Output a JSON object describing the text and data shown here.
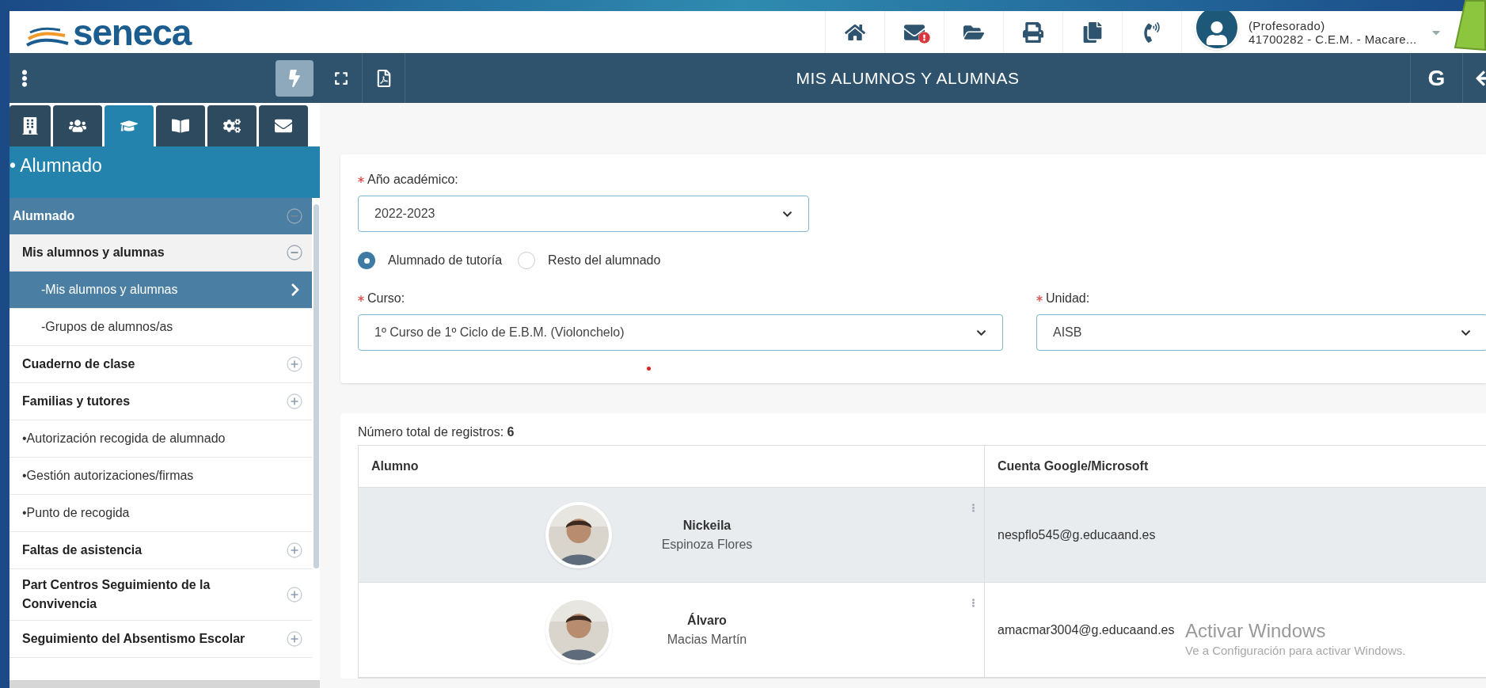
{
  "header": {
    "logo": "seneca",
    "user": {
      "role": "(Profesorado)",
      "center": "41700282 - C.E.M. - Macare..."
    }
  },
  "title_bar": {
    "title": "MIS ALUMNOS Y ALUMNAS",
    "g_button": "G"
  },
  "sidebar": {
    "tabs": [
      {
        "kind": "building",
        "selected": false
      },
      {
        "kind": "users",
        "selected": false
      },
      {
        "kind": "graduation",
        "selected": true
      },
      {
        "kind": "book",
        "selected": false
      },
      {
        "kind": "gears",
        "selected": false
      },
      {
        "kind": "mail",
        "selected": false
      }
    ],
    "section": "• Alumnado",
    "menu": {
      "label": "Alumnado",
      "expanded": true,
      "children": [
        {
          "kind": "folder",
          "label": "Mis alumnos y alumnas",
          "expanded": true,
          "children": [
            {
              "label": "-Mis alumnos y alumnas",
              "selected": true
            },
            {
              "label": "-Grupos de alumnos/as",
              "selected": false
            }
          ]
        },
        {
          "kind": "folder",
          "label": "Cuaderno de clase",
          "expanded": false
        },
        {
          "kind": "folder",
          "label": "Familias y tutores",
          "expanded": false
        },
        {
          "kind": "link",
          "label": "•Autorización recogida de alumnado",
          "selected": false
        },
        {
          "kind": "link",
          "label": "•Gestión autorizaciones/firmas",
          "selected": false
        },
        {
          "kind": "link",
          "label": "•Punto de recogida",
          "selected": false
        },
        {
          "kind": "folder",
          "label": "Faltas de asistencia",
          "expanded": false
        },
        {
          "kind": "folder",
          "label": "Part Centros Seguimiento de la Convivencia",
          "expanded": false
        },
        {
          "kind": "folder",
          "label": "Seguimiento del Absentismo Escolar",
          "expanded": false
        }
      ]
    }
  },
  "form": {
    "year": {
      "label": "Año académico:",
      "value": "2022-2023"
    },
    "radios": [
      {
        "label": "Alumnado de tutoría",
        "selected": true
      },
      {
        "label": "Resto del alumnado",
        "selected": false
      }
    ],
    "course": {
      "label": "Curso:",
      "value": "1º Curso de 1º Ciclo de E.B.M. (Violonchelo)"
    },
    "unit": {
      "label": "Unidad:",
      "value": "AISB"
    }
  },
  "table": {
    "total_label": "Número total de registros:",
    "total": "6",
    "columns": [
      "Alumno",
      "Cuenta Google/Microsoft"
    ],
    "rows": [
      {
        "first_name": "Nickeila",
        "last_name": "Espinoza Flores",
        "account": "nespflo545@g.educaand.es",
        "selected": true
      },
      {
        "first_name": "Álvaro",
        "last_name": "Macias Martín",
        "account": "amacmar3004@g.educaand.es",
        "selected": false
      }
    ]
  },
  "os_notice": {
    "title": "Activar Windows",
    "text": "Ve a Configuración para activar Windows."
  }
}
